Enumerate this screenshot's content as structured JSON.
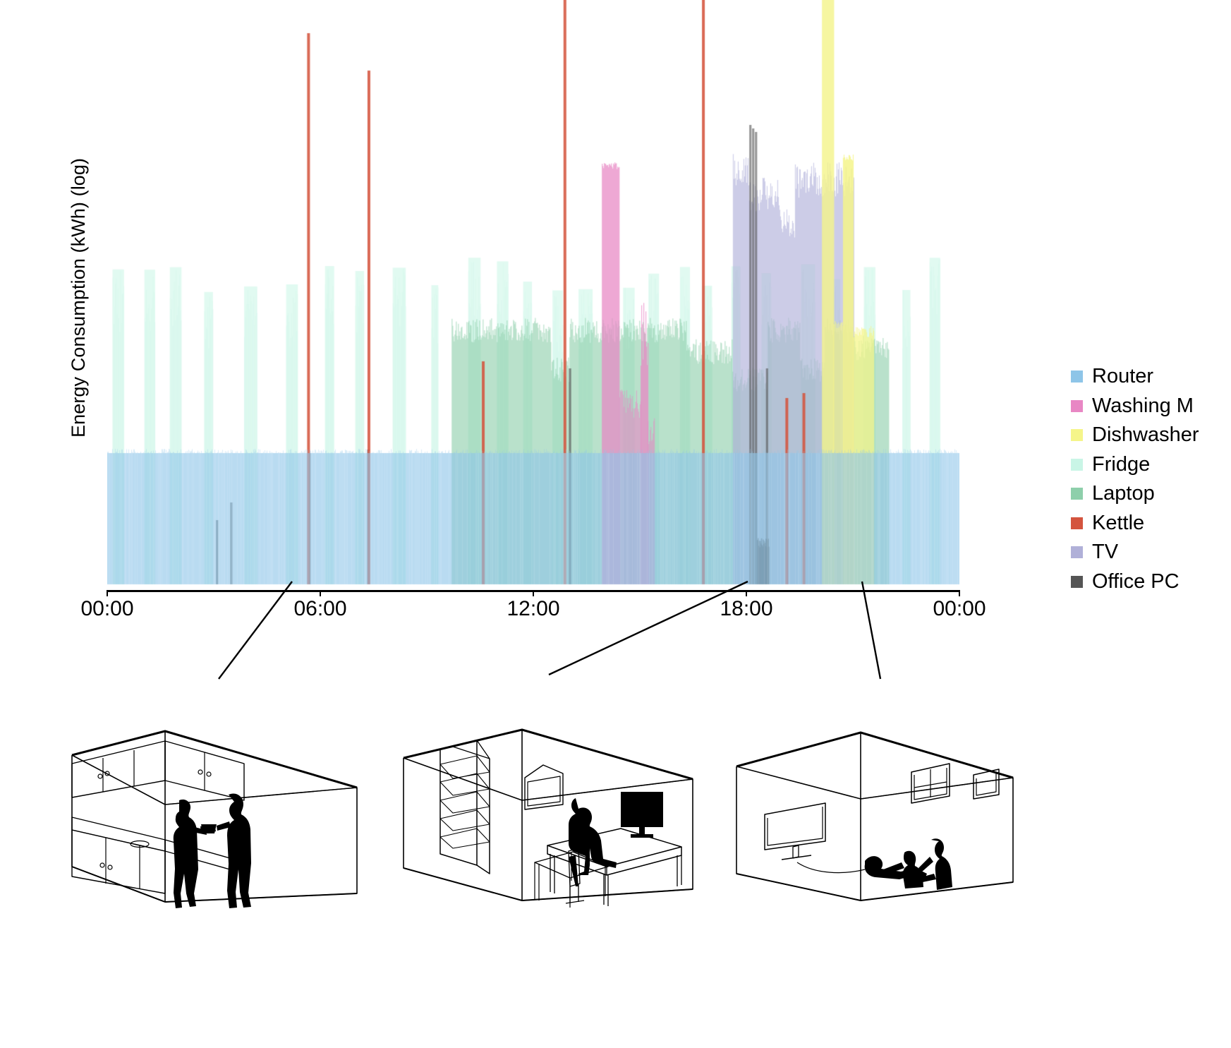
{
  "chart_data": {
    "type": "area",
    "title": "",
    "xlabel": "",
    "ylabel": "Energy Consumption (kWh) (log)",
    "yscale": "log",
    "grid": false,
    "legend_position": "right",
    "x_tick_labels": [
      "00:00",
      "06:00",
      "12:00",
      "18:00",
      "00:00"
    ],
    "x_tick_hours": [
      0,
      6,
      12,
      18,
      24
    ],
    "x_range_hours": [
      0,
      24
    ],
    "stacked": true,
    "series": [
      {
        "name": "Router",
        "color": "#8ec5e8",
        "description": "Constant always-on baseline across the full 24 h at the lowest band level",
        "active_intervals": [
          [
            0,
            24
          ]
        ],
        "level": 0.22,
        "values_by_hour": [
          0.22,
          0.22,
          0.22,
          0.22,
          0.22,
          0.22,
          0.22,
          0.22,
          0.22,
          0.22,
          0.22,
          0.22,
          0.22,
          0.22,
          0.22,
          0.22,
          0.22,
          0.22,
          0.22,
          0.22,
          0.22,
          0.22,
          0.22,
          0.22
        ]
      },
      {
        "name": "Washing M",
        "color": "#e887c4",
        "description": "Single tall afternoon cycle around 14:00-15:30 plus a short secondary spike",
        "active_intervals": [
          [
            13.9,
            15.4
          ]
        ],
        "peak_hour": 14.2,
        "peak_level": 0.8,
        "values_by_hour": [
          0,
          0,
          0,
          0,
          0,
          0,
          0,
          0,
          0,
          0,
          0,
          0,
          0,
          0,
          0.8,
          0.62,
          0,
          0,
          0,
          0,
          0,
          0,
          0,
          0
        ]
      },
      {
        "name": "Dishwasher",
        "color": "#f5f58a",
        "description": "Late-evening cycle around 20:15-21:30 with two very tall peaks",
        "active_intervals": [
          [
            20.1,
            21.6
          ]
        ],
        "peak_hour": 20.6,
        "peak_level": 1.0,
        "values_by_hour": [
          0,
          0,
          0,
          0,
          0,
          0,
          0,
          0,
          0,
          0,
          0,
          0,
          0,
          0,
          0,
          0,
          0,
          0,
          0,
          0,
          1.0,
          0.86,
          0,
          0
        ]
      },
      {
        "name": "Fridge",
        "color": "#c9f5e6",
        "description": "Regular compressor cycles: narrow tall stripes recurring roughly every 30-45 minutes all day",
        "active_intervals": [
          [
            0,
            24
          ]
        ],
        "cycle_minutes": 40,
        "peak_level": 0.62,
        "values_by_hour": [
          0.62,
          0.62,
          0.62,
          0.62,
          0.62,
          0.62,
          0.62,
          0.62,
          0.62,
          0.62,
          0.62,
          0.62,
          0.62,
          0.62,
          0.62,
          0.62,
          0.62,
          0.62,
          0.62,
          0.62,
          0.62,
          0.62,
          0.62,
          0.62
        ]
      },
      {
        "name": "Laptop",
        "color": "#8ecfab",
        "description": "Work-day usage from about 09:45 to 22:00, noisy mid-level plateau",
        "active_intervals": [
          [
            9.7,
            22.0
          ]
        ],
        "level": 0.4,
        "values_by_hour": [
          0,
          0,
          0,
          0,
          0,
          0,
          0,
          0,
          0,
          0,
          0.4,
          0.42,
          0.41,
          0.38,
          0.42,
          0.4,
          0.39,
          0.41,
          0.43,
          0.42,
          0.4,
          0.38,
          0,
          0
        ]
      },
      {
        "name": "Kettle",
        "color": "#d4543e",
        "description": "Very short full-height spikes at breakfast, mid-morning, lunch, afternoon tea and evening",
        "active_intervals": [
          [
            5.62,
            5.68
          ],
          [
            7.32,
            7.38
          ],
          [
            10.55,
            10.6
          ],
          [
            12.85,
            12.92
          ],
          [
            16.75,
            16.82
          ],
          [
            19.1,
            19.15
          ],
          [
            19.6,
            19.65
          ]
        ],
        "spike_hours": [
          5.65,
          7.35,
          10.57,
          12.88,
          16.78,
          19.12,
          19.62
        ],
        "peak_level": 1.0
      },
      {
        "name": "TV",
        "color": "#b0b0d8",
        "description": "Evening viewing from roughly 17:40 to 21:00 plus brief early-morning standby blips",
        "active_intervals": [
          [
            17.6,
            21.0
          ]
        ],
        "level": 0.55,
        "values_by_hour": [
          0,
          0,
          0,
          0,
          0,
          0,
          0,
          0,
          0,
          0,
          0,
          0,
          0,
          0,
          0,
          0,
          0,
          0.55,
          0.58,
          0.56,
          0.54,
          0,
          0,
          0
        ]
      },
      {
        "name": "Office PC",
        "color": "#555555",
        "description": "Narrow dark spikes: short early-morning standby ticks and a tall home-office session near 18:15-18:45",
        "active_intervals": [
          [
            17.9,
            18.9
          ]
        ],
        "spike_hours": [
          3.1,
          3.5,
          5.7,
          7.35,
          18.1,
          18.25,
          18.6
        ],
        "peak_level": 0.92
      }
    ]
  },
  "axes": {
    "y_label": "Energy Consumption (kWh) (log)",
    "x_ticks": [
      "00:00",
      "06:00",
      "12:00",
      "18:00",
      "00:00"
    ]
  },
  "legend": {
    "items": [
      {
        "label": "Router",
        "color": "#8ec5e8"
      },
      {
        "label": "Washing M",
        "color": "#e887c4"
      },
      {
        "label": "Dishwasher",
        "color": "#f5f58a"
      },
      {
        "label": "Fridge",
        "color": "#c9f5e6"
      },
      {
        "label": "Laptop",
        "color": "#8ecfab"
      },
      {
        "label": "Kettle",
        "color": "#d4543e"
      },
      {
        "label": "TV",
        "color": "#b0b0d8"
      },
      {
        "label": "Office PC",
        "color": "#555555"
      }
    ]
  },
  "rooms": [
    {
      "name": "kitchen",
      "caption": ""
    },
    {
      "name": "home-office",
      "caption": ""
    },
    {
      "name": "living-room",
      "caption": ""
    }
  ],
  "colors": {
    "axis": "#000000",
    "background": "#ffffff",
    "line": "#000000"
  }
}
